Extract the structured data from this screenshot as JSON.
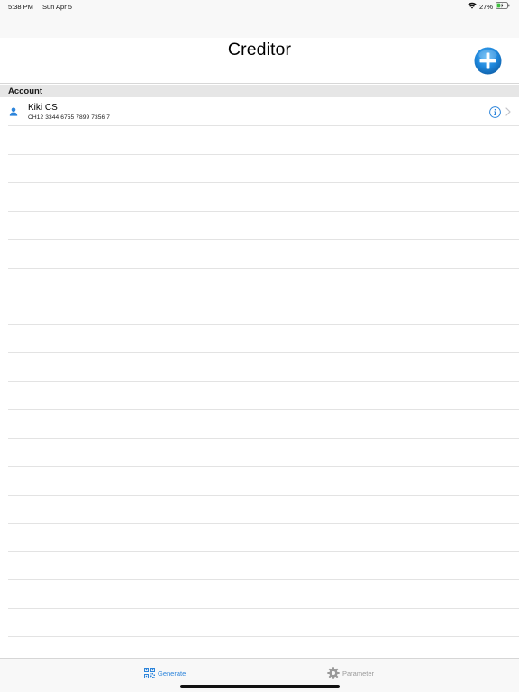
{
  "status_bar": {
    "time": "5:38 PM",
    "date": "Sun Apr 5",
    "battery": "27%",
    "icons": [
      "wifi-icon",
      "battery-charging-icon"
    ]
  },
  "header": {
    "title": "Creditor",
    "add_icon": "plus-circle-icon"
  },
  "section": {
    "header": "Account"
  },
  "accounts": [
    {
      "name": "Kiki CS",
      "iban": "CH12 3344 6755 7899 7356 7",
      "icons": [
        "person-icon",
        "info-icon",
        "chevron-right-icon"
      ]
    }
  ],
  "tabs": [
    {
      "label": "Generate",
      "icon": "qr-code-icon",
      "active": true
    },
    {
      "label": "Parameter",
      "icon": "gear-icon",
      "active": false
    }
  ],
  "colors": {
    "accent": "#2d85db",
    "inactive": "#9a9a9a",
    "add_button": "#1b80d4"
  }
}
